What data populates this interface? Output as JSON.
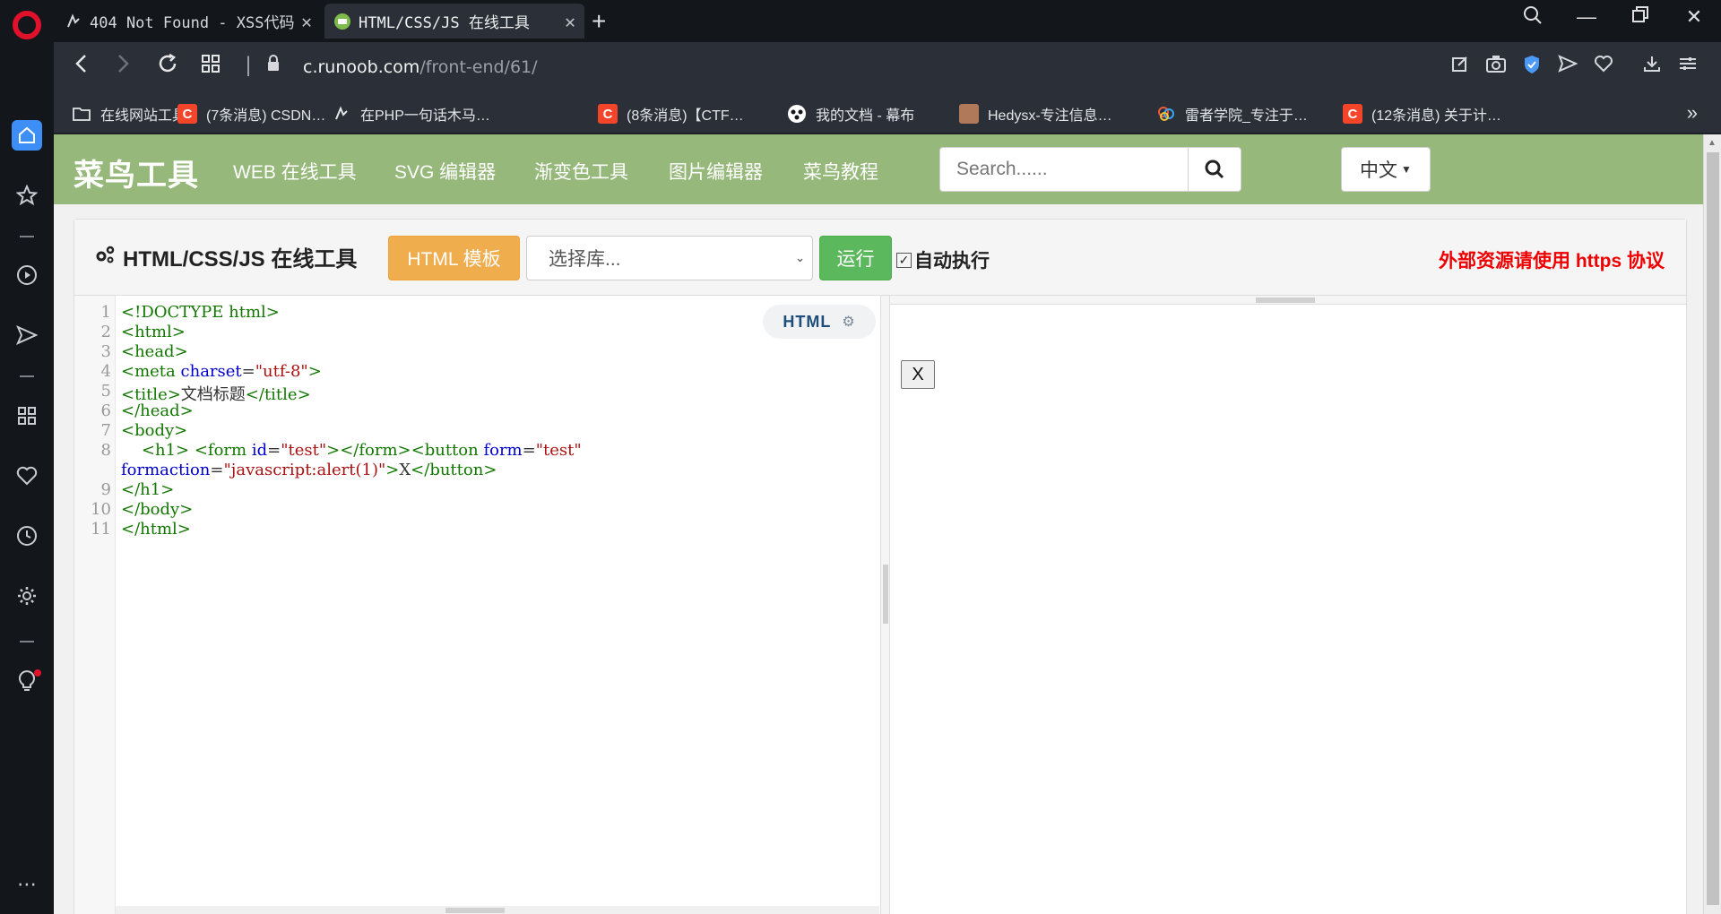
{
  "browser": {
    "tabs": [
      {
        "title": "404 Not Found - XSS代码",
        "active": false
      },
      {
        "title": "HTML/CSS/JS 在线工具",
        "active": true
      }
    ],
    "url": {
      "host": "c.runoob.com",
      "path": "/front-end/61/"
    },
    "bookmarks": [
      {
        "label": "在线网站工具",
        "icon": "folder-icon"
      },
      {
        "label": "(7条消息) CSDN…",
        "icon": "csdn-icon"
      },
      {
        "label": "在PHP一句话木马…",
        "icon": "opera-tab-icon"
      },
      {
        "label": "(8条消息)【CTF…",
        "icon": "csdn-icon"
      },
      {
        "label": "我的文档 - 幕布",
        "icon": "mubu-icon"
      },
      {
        "label": "Hedysx-专注信息…",
        "icon": "avatar-icon"
      },
      {
        "label": "雷者学院_专注于…",
        "icon": "cloud-icon"
      },
      {
        "label": "(12条消息) 关于计…",
        "icon": "csdn-icon"
      }
    ],
    "csdn_letter": "C"
  },
  "site": {
    "logo": "菜鸟工具",
    "nav": [
      "WEB 在线工具",
      "SVG 编辑器",
      "渐变色工具",
      "图片编辑器",
      "菜鸟教程"
    ],
    "search_placeholder": "Search......",
    "lang": "中文"
  },
  "tool": {
    "title": "HTML/CSS/JS 在线工具",
    "template_btn": "HTML 模板",
    "lib_select": "选择库...",
    "run_btn": "运行",
    "auto_run_label": "自动执行",
    "auto_run_checked": true,
    "https_note": "外部资源请使用 https 协议",
    "mode": "HTML"
  },
  "editor": {
    "line_numbers": [
      "1",
      "2",
      "3",
      "4",
      "5",
      "6",
      "7",
      "8",
      "",
      "9",
      "10",
      "11"
    ]
  },
  "preview": {
    "button_label": "X"
  },
  "colors": {
    "nav_green": "#96b97b",
    "template_orange": "#f0ad4e",
    "run_green": "#5cb85c",
    "warning_red": "#ee0000",
    "tag_green": "#117700",
    "attr_blue": "#0000cc",
    "string_red": "#aa1111"
  }
}
